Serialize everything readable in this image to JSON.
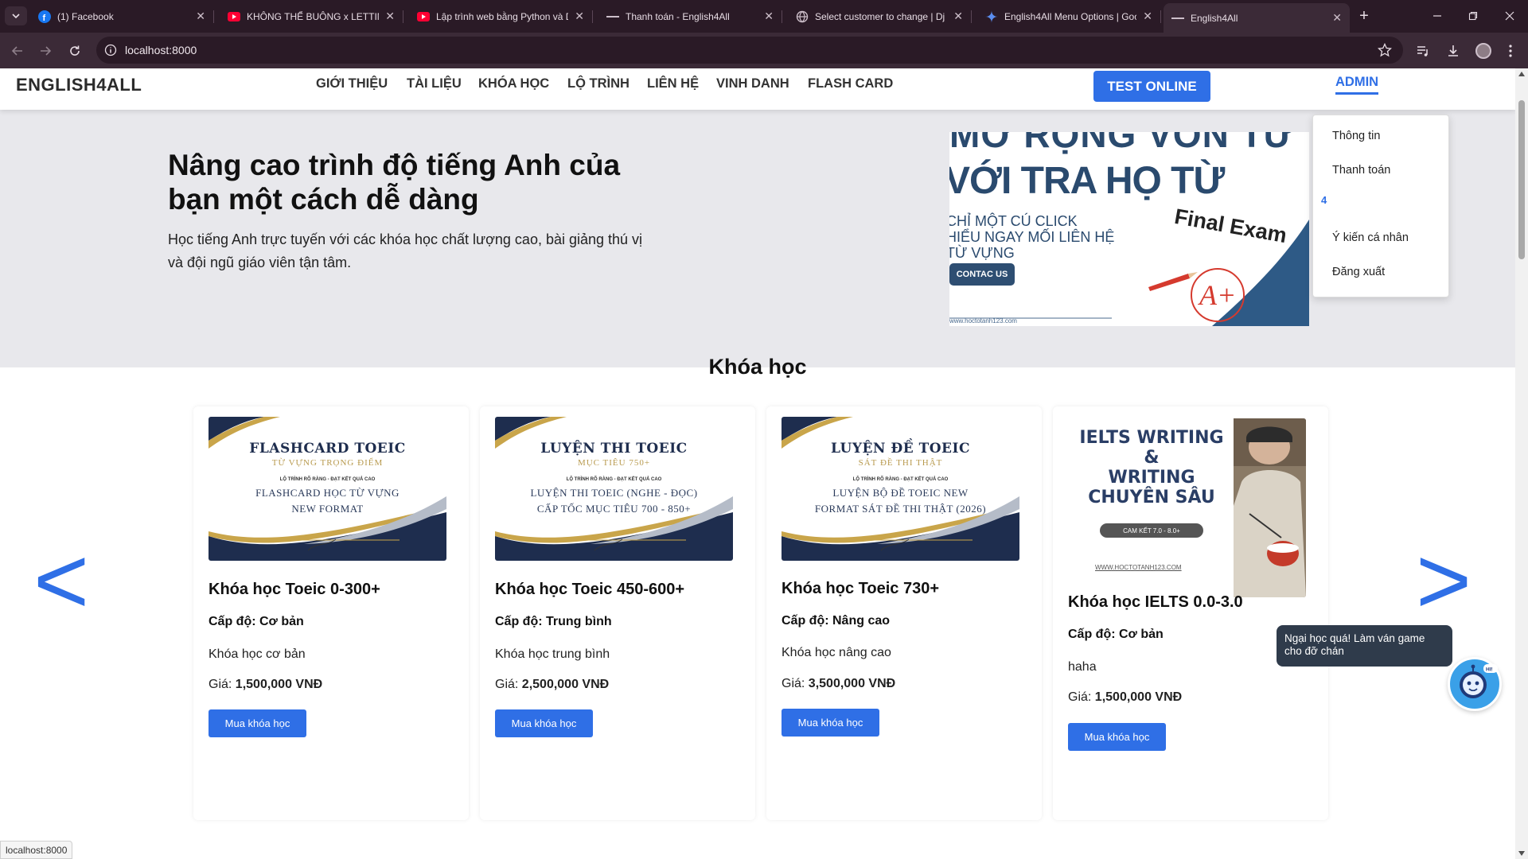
{
  "browser": {
    "tabs": [
      {
        "title": "(1) Facebook",
        "icon": "facebook-icon"
      },
      {
        "title": "KHÔNG THỂ BUÔNG x LETTING",
        "icon": "youtube-icon"
      },
      {
        "title": "Lập trình web bằng Python và D",
        "icon": "youtube-icon"
      },
      {
        "title": "Thanh toán - English4All",
        "icon": "dash-icon"
      },
      {
        "title": "Select customer to change | Dj",
        "icon": "globe-icon"
      },
      {
        "title": "English4All Menu Options | Goo",
        "icon": "gemini-icon"
      },
      {
        "title": "English4All",
        "icon": "dash-icon"
      }
    ],
    "active_tab": 6,
    "url": "localhost:8000",
    "status_url": "localhost:8000"
  },
  "header": {
    "logo": "ENGLISH4ALL",
    "nav": [
      "GIỚI THIỆU",
      "TÀI LIỆU",
      "KHÓA HỌC",
      "LỘ TRÌNH",
      "LIÊN HỆ",
      "VINH DANH",
      "FLASH CARD"
    ],
    "test_online": "TEST ONLINE",
    "admin": "ADMIN"
  },
  "dropdown": {
    "items": [
      "Thông tin",
      "Thanh toán",
      "Ý kiến cá nhân",
      "Đăng xuất"
    ],
    "badge": "4"
  },
  "hero": {
    "title": "Nâng cao trình độ tiếng Anh của bạn một cách dễ dàng",
    "subtitle": "Học tiếng Anh trực tuyến với các khóa học chất lượng cao, bài giảng thú vị và đội ngũ giáo viên tận tâm.",
    "banner": {
      "line1": "MỞ RỘNG VỐN TỪ",
      "line2": "VỚI TRA HỌ TỪ",
      "small1": "CHỈ MỘT CÚ CLICK",
      "small2": "HIỂU NGAY MỐI LIÊN HỆ",
      "small3": "TỪ VỰNG",
      "contact": "CONTAC US",
      "final": "Final Exam",
      "website": "www.hoctotanh123.com"
    }
  },
  "courses": {
    "title": "Khóa học",
    "prev": "<",
    "next": ">",
    "items": [
      {
        "img": {
          "big": "FLASHCARD TOEIC",
          "gold": "TỪ VỰNG TRỌNG ĐIỂM",
          "tiny": "LỘ TRÌNH RÕ RÀNG - ĐẠT KẾT QUẢ CAO",
          "mid1": "FLASHCARD HỌC TỪ VỰNG",
          "mid2": "NEW FORMAT"
        },
        "title": "Khóa học Toeic 0-300+",
        "level": "Cấp độ: Cơ bản",
        "desc": "Khóa học cơ bản",
        "price_label": "Giá:",
        "price": "1,500,000 VNĐ",
        "buy": "Mua khóa học"
      },
      {
        "img": {
          "big": "LUYỆN THI TOEIC",
          "gold": "MỤC TIÊU 750+",
          "tiny": "LỘ TRÌNH RÕ RÀNG - ĐẠT KẾT QUẢ CAO",
          "mid1": "LUYỆN THI TOEIC (NGHE - ĐỌC)",
          "mid2": "CẤP TỐC MỤC TIÊU 700 - 850+"
        },
        "title": "Khóa học Toeic 450-600+",
        "level": "Cấp độ: Trung bình",
        "desc": "Khóa học trung bình",
        "price_label": "Giá:",
        "price": "2,500,000 VNĐ",
        "buy": "Mua khóa học"
      },
      {
        "img": {
          "big": "LUYỆN ĐỀ TOEIC",
          "gold": "SÁT ĐỀ THI THẬT",
          "tiny": "LỘ TRÌNH RÕ RÀNG - ĐẠT KẾT QUẢ CAO",
          "mid1": "LUYỆN BỘ ĐỀ TOEIC NEW",
          "mid2": "FORMAT SÁT ĐỀ THI THẬT (2026)"
        },
        "title": "Khóa học Toeic 730+",
        "level": "Cấp độ: Nâng cao",
        "desc": "Khóa học nâng cao",
        "price_label": "Giá:",
        "price": "3,500,000 VNĐ",
        "buy": "Mua khóa học"
      },
      {
        "img": {
          "big": "IELTS WRITING",
          "amp": "&",
          "line2": "WRITING",
          "line3": "CHUYÊN SÂU",
          "pill": "CAM KẾT 7.0 - 8.0+",
          "website": "WWW.HOCTOTANH123.COM"
        },
        "title": "Khóa học IELTS 0.0-3.0",
        "level": "Cấp độ: Cơ bản",
        "desc": "haha",
        "price_label": "Giá:",
        "price": "1,500,000 VNĐ",
        "buy": "Mua khóa học"
      }
    ]
  },
  "chat": {
    "bubble": "Ngại học quá! Làm ván game cho đỡ chán",
    "icon_tag": "HI!"
  },
  "colors": {
    "accent": "#2f6fe6",
    "browser_dark": "#2a1a26",
    "hero_bg": "#e8e8ec",
    "navy": "#1e2d4e"
  }
}
